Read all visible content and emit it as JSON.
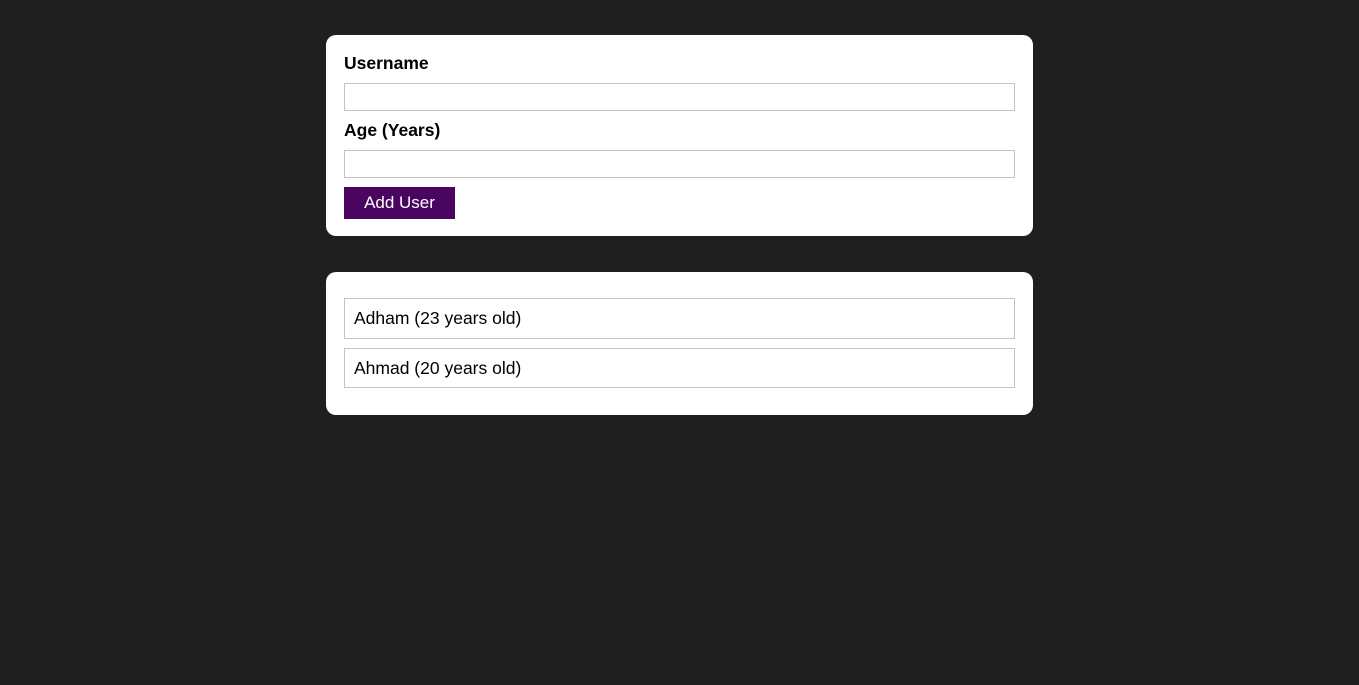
{
  "form": {
    "username_label": "Username",
    "username_value": "",
    "age_label": "Age (Years)",
    "age_value": "",
    "submit_label": "Add User"
  },
  "users": [
    {
      "text": "Adham (23 years old)"
    },
    {
      "text": "Ahmad (20 years old)"
    }
  ],
  "colors": {
    "background": "#1f1f1f",
    "card": "#ffffff",
    "button": "#4a0560",
    "input_border": "#c4c4c4"
  }
}
